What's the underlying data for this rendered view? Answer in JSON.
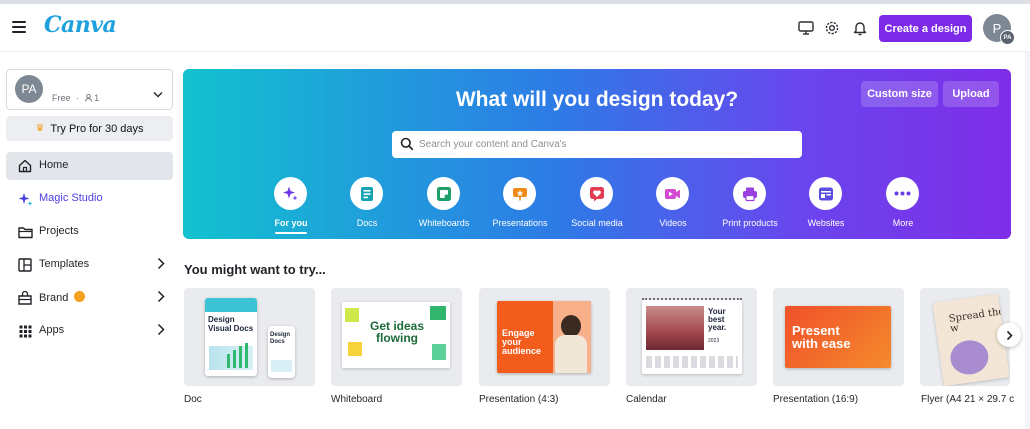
{
  "header": {
    "logo": "Canva",
    "create_label": "Create a design",
    "avatar_initials": "P",
    "avatar_badge": "PA",
    "icons": [
      "menu-icon",
      "monitor-icon",
      "settings-icon",
      "bell-icon"
    ]
  },
  "sidebar": {
    "account": {
      "initials": "PA",
      "plan": "Free",
      "members": "1"
    },
    "trypro_label": "Try Pro for 30 days",
    "items": [
      {
        "label": "Home",
        "icon": "home-icon",
        "active": true
      },
      {
        "label": "Magic Studio",
        "icon": "sparkle-icon"
      },
      {
        "label": "Projects",
        "icon": "folder-icon"
      },
      {
        "label": "Templates",
        "icon": "template-icon"
      },
      {
        "label": "Brand",
        "icon": "brand-icon"
      },
      {
        "label": "Apps",
        "icon": "apps-grid-icon"
      }
    ]
  },
  "hero": {
    "title": "What will you design today?",
    "custom_size_label": "Custom size",
    "upload_label": "Upload",
    "search_placeholder": "Search your content and Canva's",
    "categories": [
      {
        "label": "For you",
        "icon": "sparkle-icon",
        "color": "#6c38e8"
      },
      {
        "label": "Docs",
        "icon": "doc-icon",
        "color": "#13a3b5"
      },
      {
        "label": "Whiteboards",
        "icon": "whiteboard-icon",
        "color": "#1f9e6a"
      },
      {
        "label": "Presentations",
        "icon": "presentation-icon",
        "color": "#f08a1c"
      },
      {
        "label": "Social media",
        "icon": "heart-icon",
        "color": "#e23b52"
      },
      {
        "label": "Videos",
        "icon": "video-icon",
        "color": "#d44ad1"
      },
      {
        "label": "Print products",
        "icon": "print-icon",
        "color": "#9a3fe0"
      },
      {
        "label": "Websites",
        "icon": "website-icon",
        "color": "#5a4fe0"
      },
      {
        "label": "More",
        "icon": "more-icon",
        "color": "#6c3ce8"
      }
    ]
  },
  "suggestions": {
    "title": "You might want to try...",
    "cards": [
      {
        "label": "Doc",
        "thumb_text": "Design Visual Docs",
        "thumb_text_2": "Design Docs"
      },
      {
        "label": "Whiteboard",
        "thumb_text": "Get ideas flowing"
      },
      {
        "label": "Presentation (4:3)",
        "thumb_text": "Engage your audience"
      },
      {
        "label": "Calendar",
        "thumb_text": "Your best year.",
        "thumb_year": "2023"
      },
      {
        "label": "Presentation (16:9)",
        "thumb_text": "Present with ease"
      },
      {
        "label": "Flyer (A4 21 × 29.7 c",
        "thumb_text": "Spread the w"
      }
    ]
  }
}
